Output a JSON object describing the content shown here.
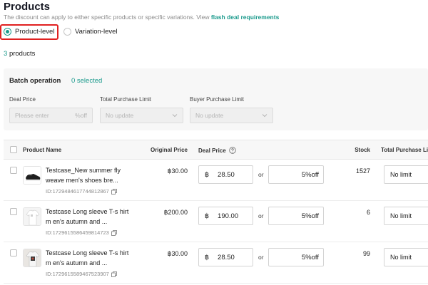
{
  "header": {
    "title": "Products",
    "description": "The discount can apply to either specific products or specific variations. View",
    "link": "flash deal requirements"
  },
  "level": {
    "options": [
      {
        "label": "Product-level",
        "selected": true
      },
      {
        "label": "Variation-level",
        "selected": false
      }
    ],
    "highlight_color": "#e02020"
  },
  "summary": {
    "count": "3",
    "unit": "products"
  },
  "batch": {
    "title": "Batch operation",
    "selected_count": "0",
    "selected_label": "selected",
    "deal_price": {
      "label": "Deal Price",
      "placeholder": "Please enter",
      "suffix": "%off"
    },
    "total_limit": {
      "label": "Total Purchase Limit",
      "value": "No update"
    },
    "buyer_limit": {
      "label": "Buyer Purchase Limit",
      "value": "No update"
    }
  },
  "table": {
    "columns": {
      "name": "Product Name",
      "original_price": "Original Price",
      "deal_price": "Deal Price",
      "stock": "Stock",
      "total_limit": "Total Purchase Lim"
    },
    "rows": [
      {
        "name": "Testcase_New summer fly weave men's shoes bre...",
        "id": "ID:1729484617744812867",
        "original_price": "฿30.00",
        "currency": "฿",
        "deal_price": "28.50",
        "or": "or",
        "discount": "5%off",
        "stock": "1527",
        "limit": "No limit",
        "thumb": "shoe"
      },
      {
        "name": "Testcase Long sleeve T-s hirt m en's autumn and ...",
        "id": "ID:1729615586459814723",
        "original_price": "฿200.00",
        "currency": "฿",
        "deal_price": "190.00",
        "or": "or",
        "discount": "5%off",
        "stock": "6",
        "limit": "No limit",
        "thumb": "shirt-white"
      },
      {
        "name": "Testcase Long sleeve T-s hirt m en's autumn and ...",
        "id": "ID:1729615589467523907",
        "original_price": "฿30.00",
        "currency": "฿",
        "deal_price": "28.50",
        "or": "or",
        "discount": "5%off",
        "stock": "99",
        "limit": "No limit",
        "thumb": "shirt-print"
      }
    ]
  },
  "colors": {
    "accent": "#1a9a8c",
    "highlight": "#e02020"
  }
}
